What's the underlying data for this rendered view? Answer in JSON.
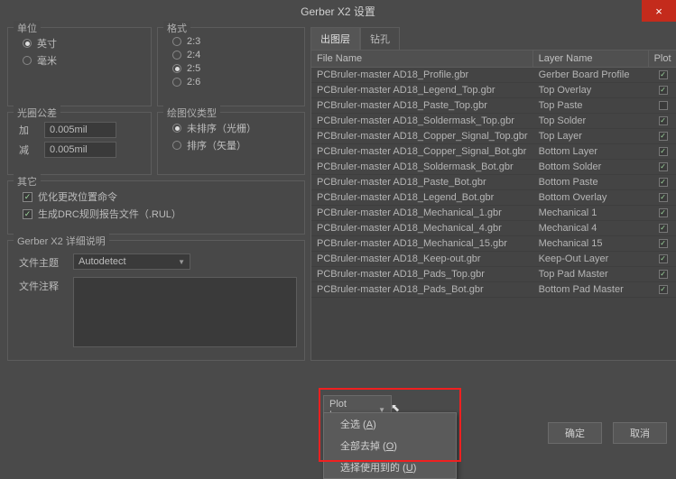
{
  "window": {
    "title": "Gerber X2 设置",
    "close_glyph": "×"
  },
  "units": {
    "legend": "单位",
    "inch": "英寸",
    "mm": "毫米"
  },
  "format": {
    "legend": "格式",
    "f23": "2:3",
    "f24": "2:4",
    "f25": "2:5",
    "f26": "2:6"
  },
  "tol": {
    "legend": "光圈公差",
    "add_label": "加",
    "sub_label": "减",
    "add_val": "0.005mil",
    "sub_val": "0.005mil"
  },
  "plottype": {
    "legend": "绘图仪类型",
    "unsorted": "未排序（光栅）",
    "sorted": "排序（矢量）"
  },
  "other": {
    "legend": "其它",
    "opt": "优化更改位置命令",
    "drc": "生成DRC规则报告文件（.RUL）"
  },
  "detail": {
    "legend": "Gerber X2 详细说明",
    "subject_label": "文件主题",
    "subject_value": "Autodetect",
    "comment_label": "文件注释"
  },
  "tabs": {
    "layers": "出图层",
    "drill": "钻孔"
  },
  "table": {
    "col_file": "File Name",
    "col_layer": "Layer Name",
    "col_plot": "Plot",
    "rows": [
      {
        "file": "PCBruler-master AD18_Profile.gbr",
        "layer": "Gerber Board Profile",
        "plot": true
      },
      {
        "file": "PCBruler-master AD18_Legend_Top.gbr",
        "layer": "Top Overlay",
        "plot": true
      },
      {
        "file": "PCBruler-master AD18_Paste_Top.gbr",
        "layer": "Top Paste",
        "plot": false
      },
      {
        "file": "PCBruler-master AD18_Soldermask_Top.gbr",
        "layer": "Top Solder",
        "plot": true
      },
      {
        "file": "PCBruler-master AD18_Copper_Signal_Top.gbr",
        "layer": "Top Layer",
        "plot": true
      },
      {
        "file": "PCBruler-master AD18_Copper_Signal_Bot.gbr",
        "layer": "Bottom Layer",
        "plot": true
      },
      {
        "file": "PCBruler-master AD18_Soldermask_Bot.gbr",
        "layer": "Bottom Solder",
        "plot": true
      },
      {
        "file": "PCBruler-master AD18_Paste_Bot.gbr",
        "layer": "Bottom Paste",
        "plot": true
      },
      {
        "file": "PCBruler-master AD18_Legend_Bot.gbr",
        "layer": "Bottom Overlay",
        "plot": true
      },
      {
        "file": "PCBruler-master AD18_Mechanical_1.gbr",
        "layer": "Mechanical 1",
        "plot": true
      },
      {
        "file": "PCBruler-master AD18_Mechanical_4.gbr",
        "layer": "Mechanical 4",
        "plot": true
      },
      {
        "file": "PCBruler-master AD18_Mechanical_15.gbr",
        "layer": "Mechanical 15",
        "plot": true
      },
      {
        "file": "PCBruler-master AD18_Keep-out.gbr",
        "layer": "Keep-Out Layer",
        "plot": true
      },
      {
        "file": "PCBruler-master AD18_Pads_Top.gbr",
        "layer": "Top Pad Master",
        "plot": true
      },
      {
        "file": "PCBruler-master AD18_Pads_Bot.gbr",
        "layer": "Bottom Pad Master",
        "plot": true
      }
    ]
  },
  "plot_layers": {
    "button": "Plot Layers",
    "menu": {
      "all_on": "全选 (",
      "all_on_k": "A",
      "all_on_e": ")",
      "all_off": "全部去掉 (",
      "all_off_k": "O",
      "all_off_e": ")",
      "used": "选择使用到的 (",
      "used_k": "U",
      "used_e": ")"
    }
  },
  "buttons": {
    "ok": "确定",
    "cancel": "取消"
  }
}
